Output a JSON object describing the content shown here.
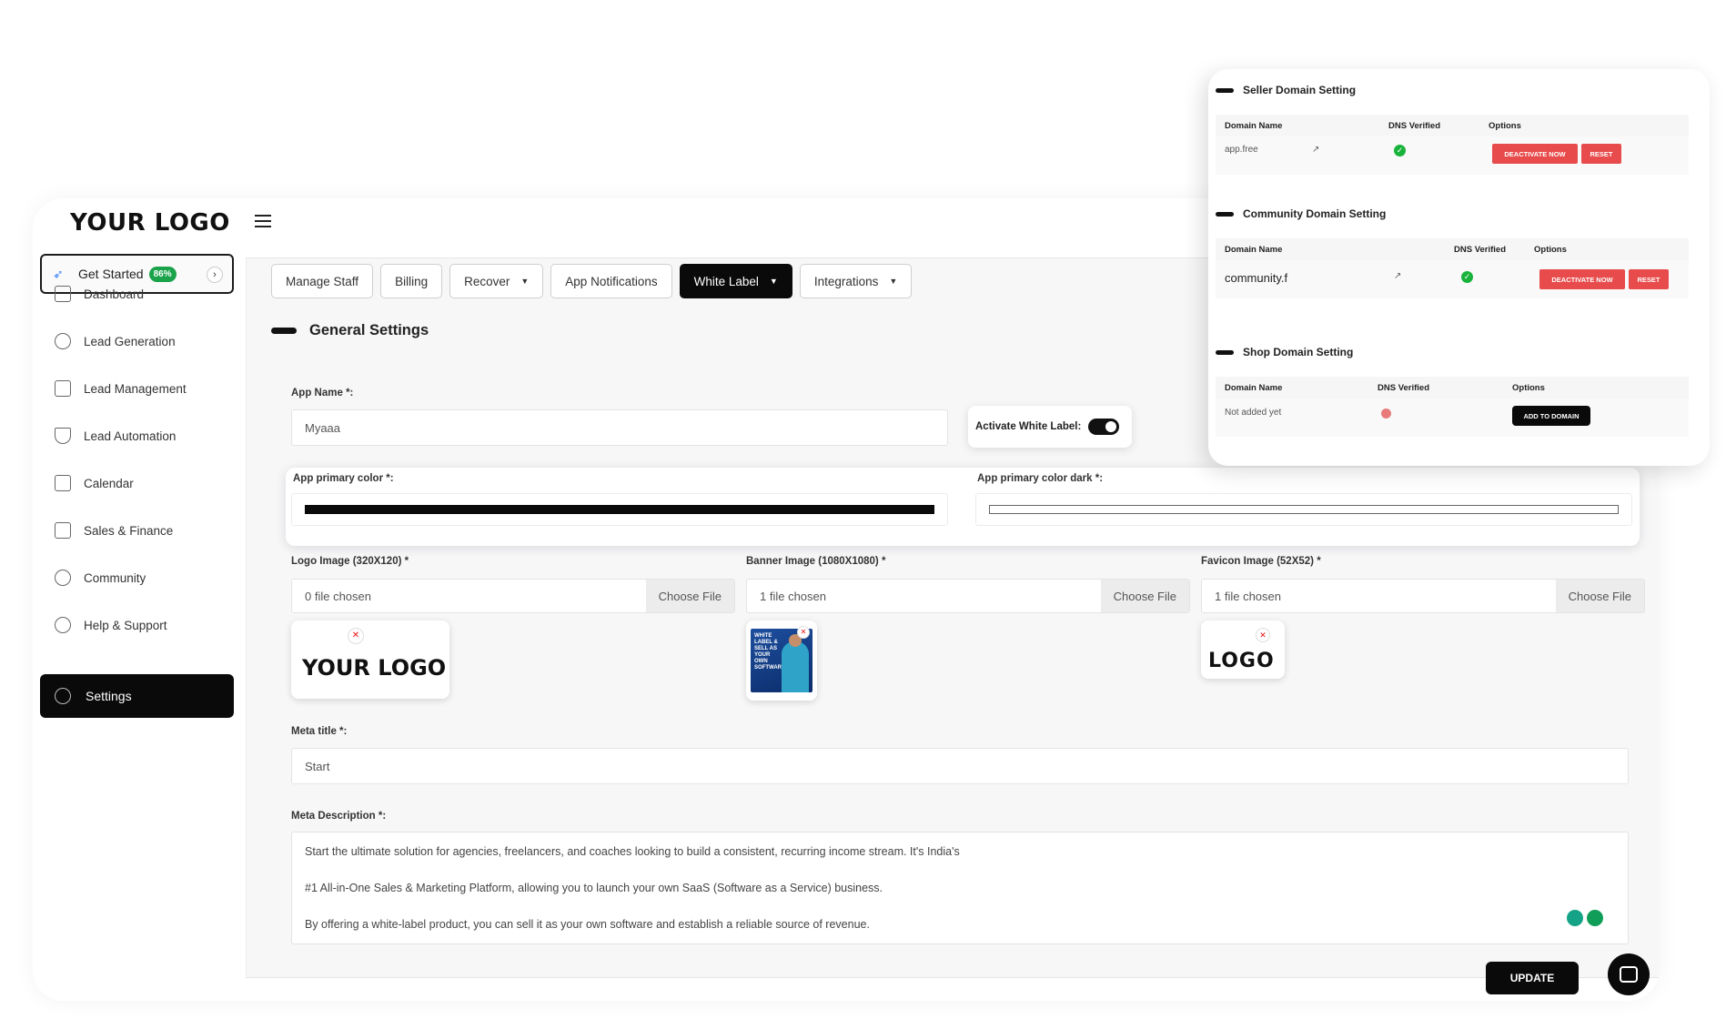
{
  "brand": {
    "logo": "YOUR LOGO"
  },
  "get_started": {
    "label": "Get Started",
    "progress": "86%"
  },
  "nav": [
    {
      "label": "Dashboard"
    },
    {
      "label": "Lead Generation"
    },
    {
      "label": "Lead Management"
    },
    {
      "label": "Lead Automation"
    },
    {
      "label": "Calendar"
    },
    {
      "label": "Sales & Finance"
    },
    {
      "label": "Community"
    },
    {
      "label": "Help & Support"
    },
    {
      "label": "Settings"
    }
  ],
  "tabs": [
    {
      "label": "Manage Staff"
    },
    {
      "label": "Billing"
    },
    {
      "label": "Recover"
    },
    {
      "label": "App Notifications"
    },
    {
      "label": "White Label"
    },
    {
      "label": "Integrations"
    }
  ],
  "general": {
    "title": "General Settings",
    "app_name_label": "App Name *:",
    "app_name_value": "Myaaa",
    "activate_label": "Activate White Label:",
    "primary_color_label": "App primary color *:",
    "primary_color_dark_label": "App primary color dark *:",
    "primary_color": "#0a0a0a",
    "primary_color_dark": "#ffffff",
    "logo_label": "Logo Image (320X120) *",
    "logo_file": "0 file chosen",
    "banner_label": "Banner Image (1080X1080) *",
    "banner_file": "1 file chosen",
    "favicon_label": "Favicon Image (52X52) *",
    "favicon_file": "1 file chosen",
    "choose_file": "Choose File",
    "logo_preview_text": "YOUR LOGO",
    "banner_preview_text": "WHITE LABEL & SELL AS YOUR OWN SOFTWARE",
    "favicon_preview_text": "LOGO",
    "meta_title_label": "Meta title *:",
    "meta_title_value": "Start⁠⁠⁠⁠",
    "meta_description_label": "Meta Description *:",
    "meta_description_lines": [
      "Start⁠⁠ the ultimate solution for agencies, freelancers, and coaches looking to build a consistent, recurring income stream. It's India's",
      "#1 All-in-One Sales & Marketing Platform, allowing you to launch your own SaaS (Software as a Service) business.",
      "By offering a white-label product, you can sell it as your own software and establish a reliable source of revenue."
    ]
  },
  "update_label": "UPDATE",
  "domains": {
    "seller": {
      "title": "Seller Domain Setting",
      "col_domain": "Domain Name",
      "col_dns": "DNS Verified",
      "col_options": "Options",
      "domain": "app.free⁠⁠⁠",
      "deactivate": "DEACTIVATE NOW",
      "reset": "RESET"
    },
    "community": {
      "title": "Community Domain Setting",
      "col_domain": "Domain Name",
      "col_dns": "DNS Verified",
      "col_options": "Options",
      "domain": "community.f⁠⁠⁠⁠",
      "deactivate": "DEACTIVATE NOW",
      "reset": "RESET"
    },
    "shop": {
      "title": "Shop Domain Setting",
      "col_domain": "Domain Name",
      "col_dns": "DNS Verified",
      "col_options": "Options",
      "domain": "Not added yet",
      "add": "ADD TO DOMAIN"
    }
  }
}
